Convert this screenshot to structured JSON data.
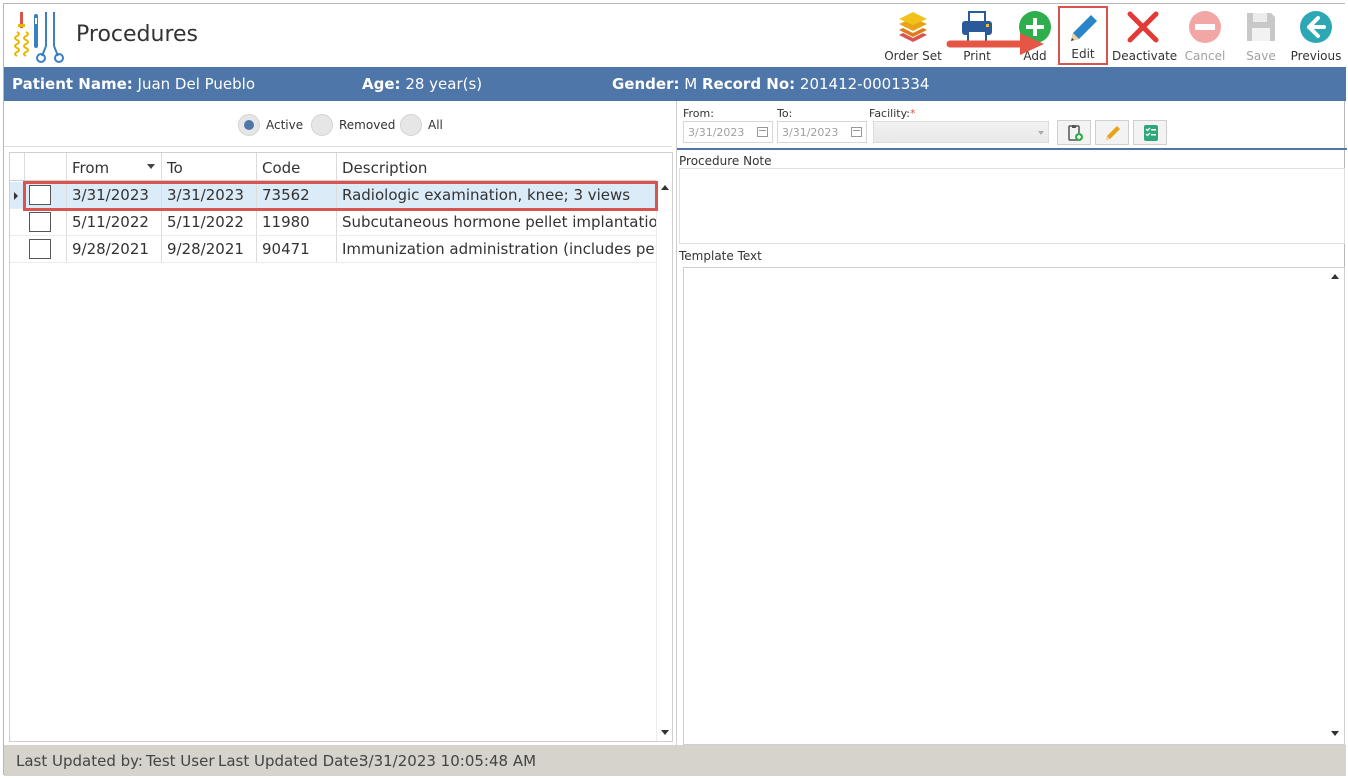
{
  "header": {
    "title": "Procedures"
  },
  "toolbar": {
    "order_set": "Order Set",
    "print": "Print",
    "add": "Add",
    "edit": "Edit",
    "deactivate": "Deactivate",
    "cancel": "Cancel",
    "save": "Save",
    "previous": "Previous"
  },
  "patient": {
    "name_label": "Patient Name:",
    "name": "Juan Del Pueblo",
    "age_label": "Age:",
    "age": "28 year(s)",
    "gender_label": "Gender:",
    "gender": "M",
    "record_label": "Record No:",
    "record": "201412-0001334"
  },
  "filter": {
    "options": [
      "Active",
      "Removed",
      "All"
    ],
    "selected": "Active"
  },
  "grid": {
    "columns": [
      "From",
      "To",
      "Code",
      "Description"
    ],
    "rows": [
      {
        "from": "3/31/2023",
        "to": "3/31/2023",
        "code": "73562",
        "description": "Radiologic examination, knee; 3 views"
      },
      {
        "from": "5/11/2022",
        "to": "5/11/2022",
        "code": "11980",
        "description": "Subcutaneous hormone pellet implantatio..."
      },
      {
        "from": "9/28/2021",
        "to": "9/28/2021",
        "code": "90471",
        "description": "Immunization administration (includes per..."
      }
    ]
  },
  "details": {
    "from_label": "From:",
    "from_value": "3/31/2023",
    "to_label": "To:",
    "to_value": "3/31/2023",
    "facility_label": "Facility:",
    "facility_required": "*",
    "procedure_note_label": "Procedure Note",
    "template_text_label": "Template Text"
  },
  "status": {
    "updated_by_label": "Last Updated by:",
    "updated_by": "Test User",
    "updated_date_label": "Last Updated Date:",
    "updated_date": "3/31/2023 10:05:48 AM"
  },
  "colors": {
    "accent": "#4f76a8",
    "highlight": "#d9534f",
    "add_green": "#2fae4e",
    "edit_blue": "#2a84c9",
    "deactivate_red": "#e53935",
    "previous_teal": "#2ea7b5"
  },
  "icons": {
    "order_set": "layers-icon",
    "print": "printer-icon",
    "add": "plus-circle-icon",
    "edit": "pencil-icon",
    "deactivate": "x-icon",
    "cancel": "minus-circle-icon",
    "save": "floppy-icon",
    "previous": "arrow-left-circle-icon"
  }
}
